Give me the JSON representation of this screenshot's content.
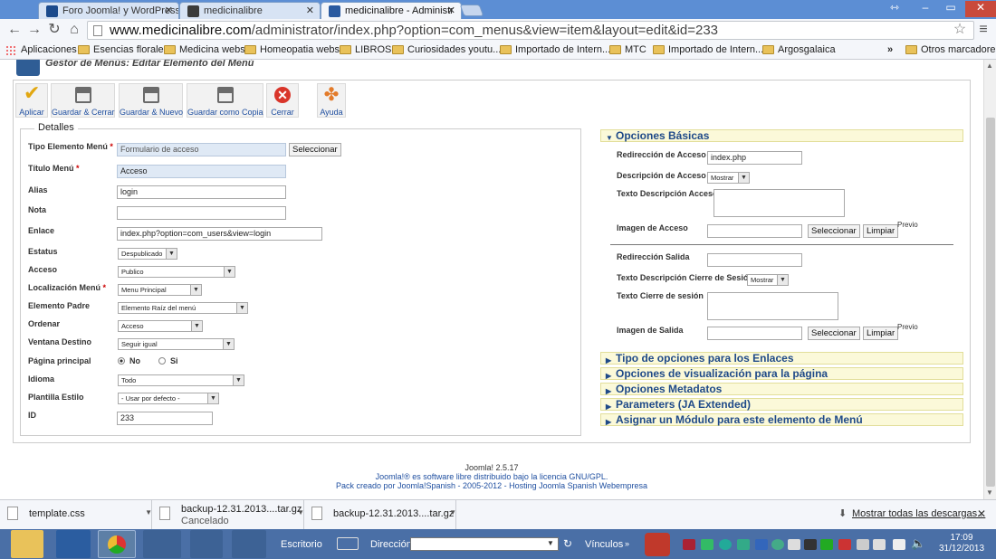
{
  "browser": {
    "tabs": [
      {
        "title": "Foro Joomla! y WordPress",
        "active": false,
        "color": "#1b4a8c"
      },
      {
        "title": "medicinalibre",
        "active": false,
        "color": "#3b3b3b"
      },
      {
        "title": "medicinalibre - Administr",
        "active": true,
        "color": "#2a5aa0"
      }
    ],
    "url_domain": "www.medicinalibre.com",
    "url_path": "/administrator/index.php?option=com_menus&view=item&layout=edit&id=233",
    "bookmarks": [
      "Aplicaciones",
      "Esencias florales",
      "Medicina webs",
      "Homeopatia webs",
      "LIBROS",
      "Curiosidades youtu...",
      "Importado de Intern...",
      "MTC",
      "Importado de Intern...",
      "Argosgalaica"
    ],
    "bookmarks_more": "»",
    "other_bookmarks": "Otros marcadores"
  },
  "page": {
    "title": "Gestor de Menús: Editar Elemento del Menú",
    "toolbar": [
      "Aplicar",
      "Guardar & Cerrar",
      "Guardar & Nuevo",
      "Guardar como Copia",
      "Cerrar",
      "Ayuda"
    ],
    "details": {
      "legend": "Detalles",
      "labels": {
        "tipo": "Tipo Elemento Menú",
        "titulo": "Título Menú",
        "alias": "Alias",
        "nota": "Nota",
        "enlace": "Enlace",
        "estatus": "Estatus",
        "acceso": "Acceso",
        "localizacion": "Localización Menú",
        "padre": "Elemento Padre",
        "ordenar": "Ordenar",
        "ventana": "Ventana Destino",
        "principal": "Página principal",
        "idioma": "Idioma",
        "plantilla": "Plantilla Estilo",
        "id": "ID"
      },
      "required_mark": "*",
      "values": {
        "tipo": "Formulario de acceso",
        "titulo": "Acceso",
        "alias": "login",
        "nota": "",
        "enlace": "index.php?option=com_users&view=login",
        "estatus": "Despublicado",
        "acceso": "Publico",
        "localizacion": "Menu Principal",
        "padre": "Elemento Raíz del menú",
        "ordenar": "Acceso",
        "ventana": "Seguir igual",
        "idioma": "Todo",
        "plantilla": "- Usar por defecto -",
        "id": "233"
      },
      "select_button": "Seleccionar",
      "radio_no": "No",
      "radio_si": "Si",
      "principal_selected": "No"
    },
    "right": {
      "basic_header": "Opciones Básicas",
      "labels": {
        "redir_acceso": "Redirección de Acceso",
        "desc_acceso": "Descripción de Acceso",
        "texto_desc_acceso": "Texto Descripción Acceso",
        "imagen_acceso": "Imagen de Acceso",
        "redir_salida": "Redirección Salida",
        "texto_desc_cierre": "Texto Descripción Cierre de Sesión",
        "texto_cierre": "Texto Cierre de sesión",
        "imagen_salida": "Imagen de Salida"
      },
      "values": {
        "redir_acceso": "index.php",
        "desc_acceso": "Mostrar",
        "desc_cierre": "Mostrar"
      },
      "btn_select": "Seleccionar",
      "btn_clear": "Limpiar",
      "previo": "Previo",
      "other_headers": [
        "Tipo de opciones para los Enlaces",
        "Opciones de visualización para la página",
        "Opciones Metadatos",
        "Parameters (JA Extended)",
        "Asignar un Módulo para este elemento de Menú"
      ]
    },
    "footer": {
      "version": "Joomla! 2.5.17",
      "license": "Joomla!® es software libre distribuido bajo la licencia GNU/GPL.",
      "pack": "Pack creado por Joomla!Spanish - 2005-2012 - Hosting Joomla Spanish Webempresa"
    }
  },
  "downloads": {
    "items": [
      {
        "name": "template.css",
        "status": ""
      },
      {
        "name": "backup-12.31.2013....tar.gz",
        "status": "Cancelado"
      },
      {
        "name": "backup-12.31.2013....tar.gz",
        "status": ""
      }
    ],
    "show_all": "Mostrar todas las descargas..."
  },
  "taskbar": {
    "escritorio": "Escritorio",
    "direccion": "Dirección",
    "vinculos": "Vínculos",
    "time": "17:09",
    "date": "31/12/2013"
  }
}
